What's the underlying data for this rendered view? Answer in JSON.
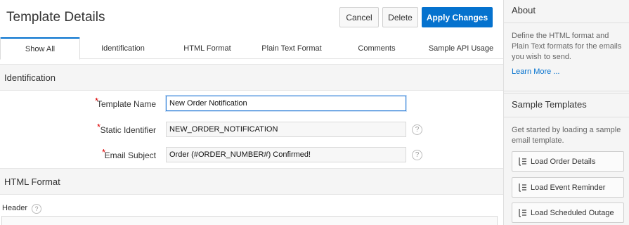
{
  "header": {
    "title": "Template Details",
    "buttons": {
      "cancel": "Cancel",
      "delete": "Delete",
      "apply": "Apply Changes"
    }
  },
  "tabs": [
    {
      "label": "Show All",
      "active": true
    },
    {
      "label": "Identification"
    },
    {
      "label": "HTML Format"
    },
    {
      "label": "Plain Text Format"
    },
    {
      "label": "Comments"
    },
    {
      "label": "Sample API Usage"
    }
  ],
  "identification": {
    "heading": "Identification",
    "required_mark": "*",
    "fields": [
      {
        "label": "Template Name",
        "value": "New Order Notification",
        "help": false
      },
      {
        "label": "Static Identifier",
        "value": "NEW_ORDER_NOTIFICATION",
        "help": true
      },
      {
        "label": "Email Subject",
        "value": "Order (#ORDER_NUMBER#) Confirmed!",
        "help": true
      }
    ],
    "help_glyph": "?"
  },
  "html_format": {
    "heading": "HTML Format",
    "header_label": "Header"
  },
  "sidebar": {
    "about": {
      "title": "About",
      "text": "Define the HTML format and Plain Text formats for the emails you wish to send.",
      "link": "Learn More ..."
    },
    "samples": {
      "title": "Sample Templates",
      "text": "Get started by loading a sample email template.",
      "buttons": [
        "Load Order Details",
        "Load Event Reminder",
        "Load Scheduled Outage"
      ]
    }
  },
  "colors": {
    "accent": "#0572ce",
    "required": "#dd0000"
  }
}
